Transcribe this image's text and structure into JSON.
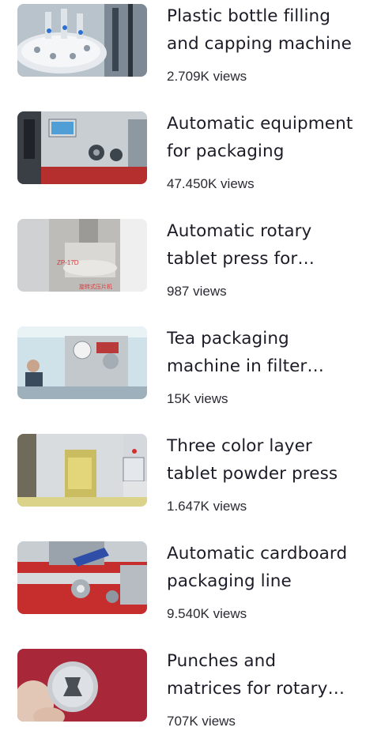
{
  "videos": [
    {
      "title": "Plastic bottle filling and capping machine",
      "views": "2.709K views",
      "thumb_icon": "bottle-filling-machine-thumbnail"
    },
    {
      "title": "Automatic equipment for packaging",
      "views": "47.450K views",
      "thumb_icon": "automatic-equipment-thumbnail"
    },
    {
      "title": "Automatic rotary tablet press for pharmaceuticals",
      "views": "987 views",
      "thumb_icon": "rotary-tablet-press-thumbnail"
    },
    {
      "title": "Tea packaging machine in filter bags",
      "views": "15K views",
      "thumb_icon": "tea-packaging-machine-thumbnail"
    },
    {
      "title": "Three color layer tablet powder press",
      "views": "1.647K views",
      "thumb_icon": "tablet-powder-press-thumbnail"
    },
    {
      "title": "Automatic cardboard packaging line",
      "views": "9.540K views",
      "thumb_icon": "cardboard-packaging-thumbnail"
    },
    {
      "title": "Punches and matrices for rotary tablet press",
      "views": "707K views",
      "thumb_icon": "punches-matrices-thumbnail"
    }
  ]
}
